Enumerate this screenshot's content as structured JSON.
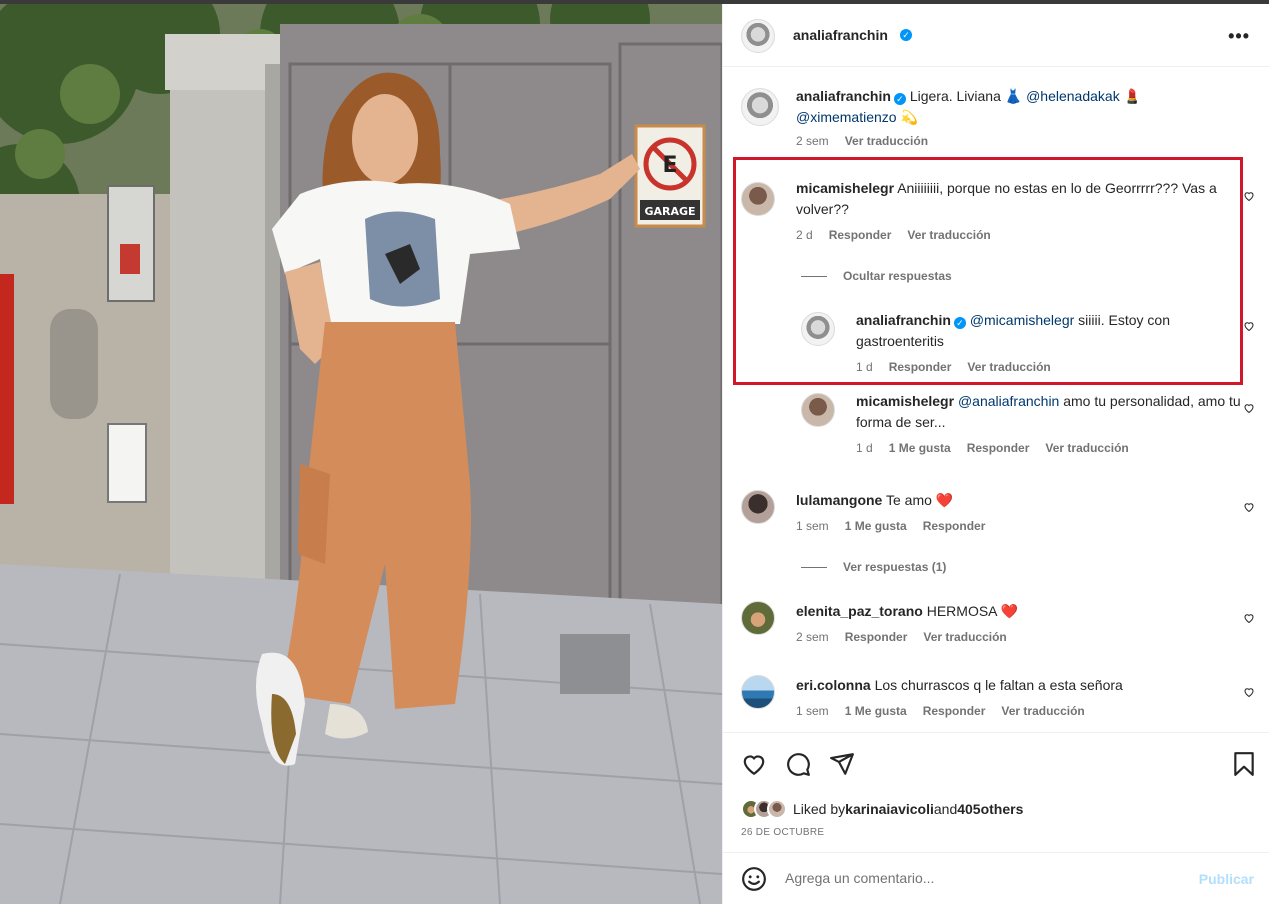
{
  "post": {
    "author": "analiafranchin",
    "caption": {
      "text": "Ligera. Liviana",
      "emoji1": "👗",
      "mention1": "@helenadakak",
      "emoji2": "💄",
      "mention2": "@ximematienzo",
      "emoji3": "💫",
      "time": "2 sem",
      "translate": "Ver traducción"
    },
    "photo": {
      "sign_text": "GARAGE"
    }
  },
  "comments": [
    {
      "user": "micamishelegr",
      "text": "Aniiiiiiii, porque no estas en lo de Georrrrr??? Vas a volver??",
      "time": "2 d",
      "reply": "Responder",
      "translate": "Ver traducción",
      "hide_replies": "Ocultar respuestas",
      "replies": [
        {
          "user": "analiafranchin",
          "mention": "@micamishelegr",
          "text": "siiiii. Estoy con gastroenteritis",
          "time": "1 d",
          "reply": "Responder",
          "translate": "Ver traducción"
        },
        {
          "user": "micamishelegr",
          "mention": "@analiafranchin",
          "text": "amo tu personalidad, amo tu forma de ser...",
          "time": "1 d",
          "likes": "1 Me gusta",
          "reply": "Responder",
          "translate": "Ver traducción"
        }
      ]
    },
    {
      "user": "lulamangone",
      "text": "Te amo",
      "emoji": "❤️",
      "time": "1 sem",
      "likes": "1 Me gusta",
      "reply": "Responder",
      "view_replies": "Ver respuestas (1)"
    },
    {
      "user": "elenita_paz_torano",
      "text": "HERMOSA",
      "emoji": "❤️",
      "time": "2 sem",
      "reply": "Responder",
      "translate": "Ver traducción"
    },
    {
      "user": "eri.colonna",
      "text": "Los churrascos q le faltan a esta señora",
      "time": "1 sem",
      "likes": "1 Me gusta",
      "reply": "Responder",
      "translate": "Ver traducción"
    }
  ],
  "likes": {
    "prefix": "Liked by",
    "user": "karinaiavicoli",
    "and": "and",
    "others": "405others"
  },
  "date": "26 DE OCTUBRE",
  "add_comment": {
    "placeholder": "Agrega un comentario...",
    "publish": "Publicar"
  },
  "icons": {
    "more": "more-options-icon",
    "like": "heart-icon",
    "comment": "comment-bubble-icon",
    "share": "paper-plane-icon",
    "save": "bookmark-icon",
    "emoji": "smiley-icon",
    "verified": "verified-badge-icon"
  },
  "colors": {
    "highlight": "#d3172a",
    "verified": "#0095f6",
    "mention": "#00376b",
    "secondary_text": "#737373",
    "publish_disabled": "#b2dffc",
    "heart_red": "#e0245e"
  }
}
